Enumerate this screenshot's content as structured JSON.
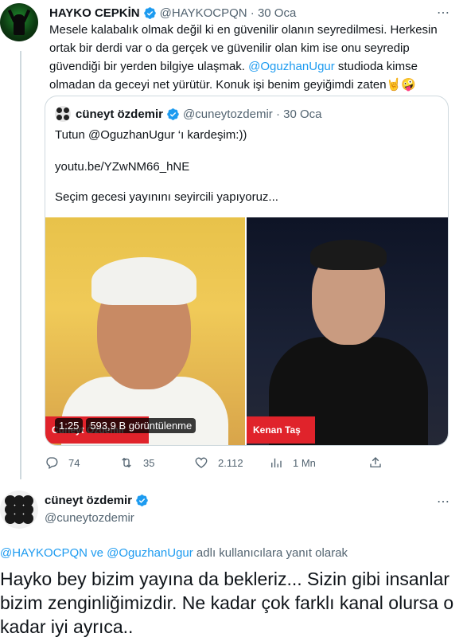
{
  "tweet": {
    "author_name": "HAYKO CEPKİN",
    "handle": "@HAYKOCPQN",
    "date": "30 Oca",
    "text_part1": "Mesele kalabalık olmak değil ki en güvenilir olanın seyredilmesi. Herkesin ortak bir derdi var o da gerçek ve güvenilir olan kim ise onu seyredip güvendiği bir yerden bilgiye ulaşmak. ",
    "mention": "@OguzhanUgur",
    "text_part2": " studioda kimse olmadan da geceyi net yürütür. Konuk işi benim geyiğimdi zaten🤘🤪",
    "more_icon": "⋯",
    "stats": {
      "replies": "74",
      "retweets": "35",
      "likes": "2.112",
      "views": "1 Mn"
    }
  },
  "quoted": {
    "author_name": "cüneyt özdemir",
    "handle": "@cuneytozdemir",
    "date": "30 Oca",
    "line1": "Tutun @OguzhanUgur ‘ı kardeşim:))",
    "line2": "youtu.be/YZwNM66_hNE",
    "line3": "Seçim gecesi yayınını seyircili yapıyoruz...",
    "video": {
      "duration": "1:25",
      "views": "593,9 B görüntülenme",
      "left_overlay": "Cüneyt Özdemir",
      "right_overlay": "Kenan Taş"
    }
  },
  "reply": {
    "author_name": "cüneyt özdemir",
    "handle": "@cuneytozdemir",
    "replying_prefix": "@HAYKOCPQN ve @OguzhanUgur",
    "replying_suffix": " adlı kullanıcılara yanıt olarak",
    "text": "Hayko bey bizim yayına da bekleriz... Sizin gibi insanlar bizim zenginliğimizdir. Ne kadar çok farklı kanal olursa o kadar iyi ayrıca..",
    "more_icon": "⋯"
  },
  "colors": {
    "accent": "#1d9bf0",
    "muted": "#536471",
    "verified": "#1d9bf0",
    "red_label": "#e0232b"
  }
}
